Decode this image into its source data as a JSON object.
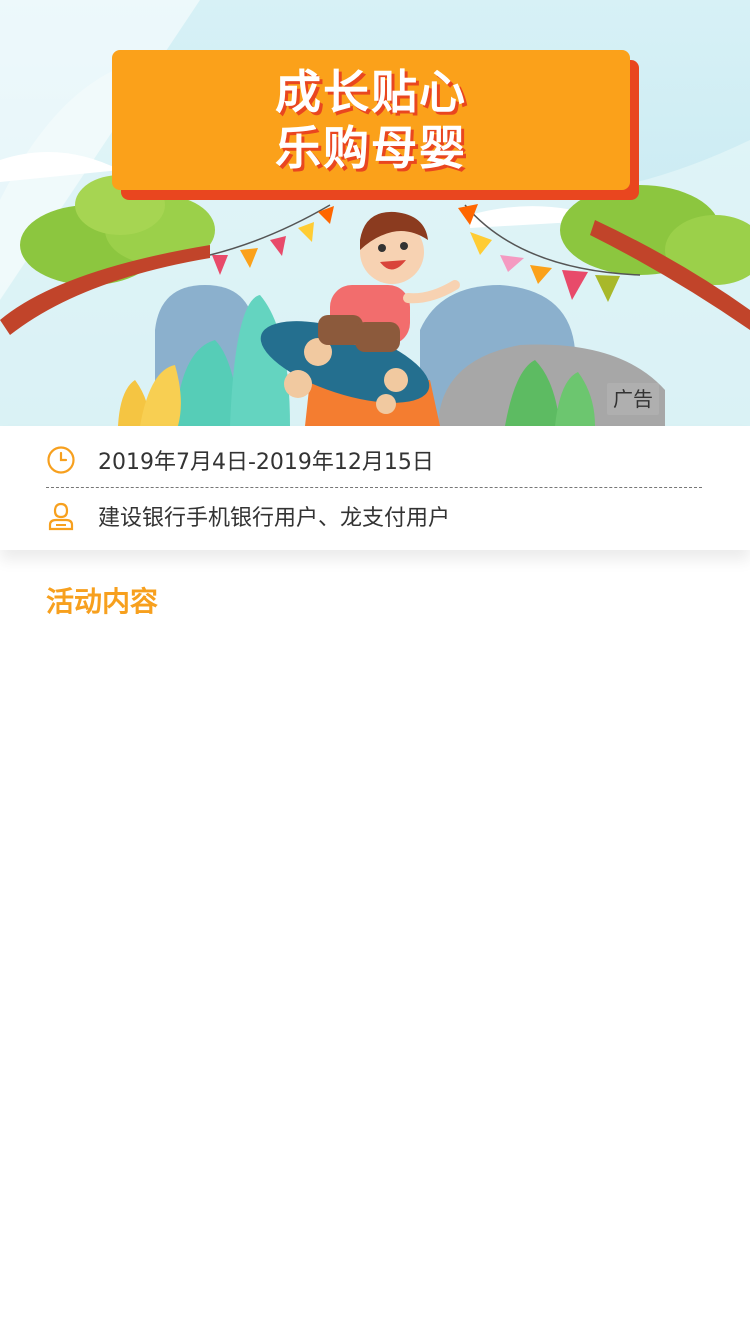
{
  "banner": {
    "title_line1": "成长贴心",
    "title_line2": "乐购母婴",
    "ad_label": "广告"
  },
  "info": {
    "date_icon": "clock-icon",
    "date_range": "2019年7月4日-2019年12月15日",
    "user_icon": "user-icon",
    "eligible_users": "建设银行手机银行用户、龙支付用户"
  },
  "section": {
    "title": "活动内容"
  },
  "colors": {
    "accent_orange": "#f7a01e",
    "title_box": "#fba11a",
    "title_shadow": "#e9461f"
  }
}
